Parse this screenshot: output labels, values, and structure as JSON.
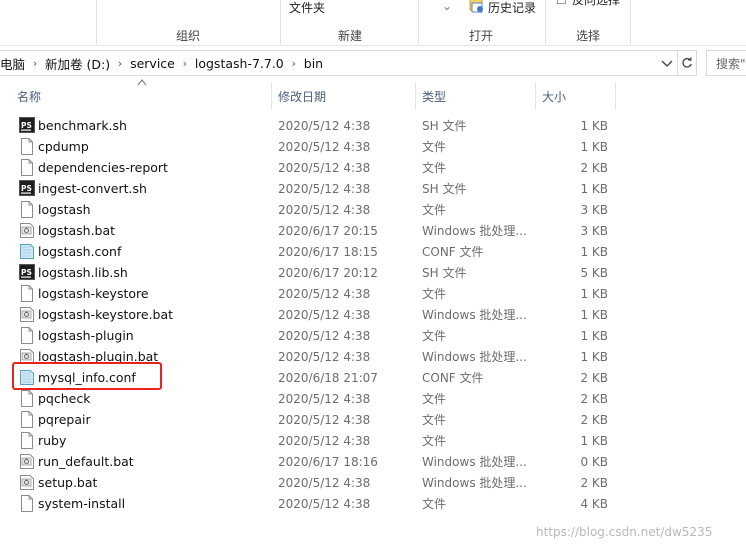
{
  "ribbon": {
    "groups": [
      "组织",
      "新建",
      "打开",
      "选择"
    ],
    "new_folder_label": "文件夹",
    "history_label": "历史记录",
    "select_label": "反向选择"
  },
  "address": {
    "crumbs": [
      "电脑",
      "新加卷 (D:)",
      "service",
      "logstash-7.7.0",
      "bin"
    ],
    "search_placeholder": "搜索\""
  },
  "columns": {
    "name": "名称",
    "modified": "修改日期",
    "type": "类型",
    "size": "大小"
  },
  "files": [
    {
      "name": "benchmark.sh",
      "date": "2020/5/12 4:38",
      "type": "SH 文件",
      "size": "1 KB",
      "icon": "powershell-icon"
    },
    {
      "name": "cpdump",
      "date": "2020/5/12 4:38",
      "type": "文件",
      "size": "1 KB",
      "icon": "blank-file-icon"
    },
    {
      "name": "dependencies-report",
      "date": "2020/5/12 4:38",
      "type": "文件",
      "size": "2 KB",
      "icon": "blank-file-icon"
    },
    {
      "name": "ingest-convert.sh",
      "date": "2020/5/12 4:38",
      "type": "SH 文件",
      "size": "1 KB",
      "icon": "powershell-icon"
    },
    {
      "name": "logstash",
      "date": "2020/5/12 4:38",
      "type": "文件",
      "size": "3 KB",
      "icon": "blank-file-icon"
    },
    {
      "name": "logstash.bat",
      "date": "2020/6/17 20:15",
      "type": "Windows 批处理...",
      "size": "3 KB",
      "icon": "batch-file-icon"
    },
    {
      "name": "logstash.conf",
      "date": "2020/6/17 18:15",
      "type": "CONF 文件",
      "size": "1 KB",
      "icon": "conf-file-icon"
    },
    {
      "name": "logstash.lib.sh",
      "date": "2020/6/17 20:12",
      "type": "SH 文件",
      "size": "5 KB",
      "icon": "powershell-icon"
    },
    {
      "name": "logstash-keystore",
      "date": "2020/5/12 4:38",
      "type": "文件",
      "size": "1 KB",
      "icon": "blank-file-icon"
    },
    {
      "name": "logstash-keystore.bat",
      "date": "2020/5/12 4:38",
      "type": "Windows 批处理...",
      "size": "1 KB",
      "icon": "batch-file-icon"
    },
    {
      "name": "logstash-plugin",
      "date": "2020/5/12 4:38",
      "type": "文件",
      "size": "1 KB",
      "icon": "blank-file-icon"
    },
    {
      "name": "logstash-plugin.bat",
      "date": "2020/5/12 4:38",
      "type": "Windows 批处理...",
      "size": "1 KB",
      "icon": "batch-file-icon"
    },
    {
      "name": "mysql_info.conf",
      "date": "2020/6/18 21:07",
      "type": "CONF 文件",
      "size": "2 KB",
      "icon": "conf-file-icon"
    },
    {
      "name": "pqcheck",
      "date": "2020/5/12 4:38",
      "type": "文件",
      "size": "2 KB",
      "icon": "blank-file-icon"
    },
    {
      "name": "pqrepair",
      "date": "2020/5/12 4:38",
      "type": "文件",
      "size": "2 KB",
      "icon": "blank-file-icon"
    },
    {
      "name": "ruby",
      "date": "2020/5/12 4:38",
      "type": "文件",
      "size": "1 KB",
      "icon": "blank-file-icon"
    },
    {
      "name": "run_default.bat",
      "date": "2020/6/17 18:16",
      "type": "Windows 批处理...",
      "size": "0 KB",
      "icon": "batch-file-icon"
    },
    {
      "name": "setup.bat",
      "date": "2020/5/12 4:38",
      "type": "Windows 批处理...",
      "size": "2 KB",
      "icon": "batch-file-icon"
    },
    {
      "name": "system-install",
      "date": "2020/5/12 4:38",
      "type": "文件",
      "size": "4 KB",
      "icon": "blank-file-icon"
    }
  ],
  "highlighted_file": "mysql_info.conf",
  "watermark": "https://blog.csdn.net/dw5235",
  "colors": {
    "highlight_border": "#e8231d",
    "column_header_text": "#4c607a",
    "secondary_text": "#6d6d6d"
  }
}
